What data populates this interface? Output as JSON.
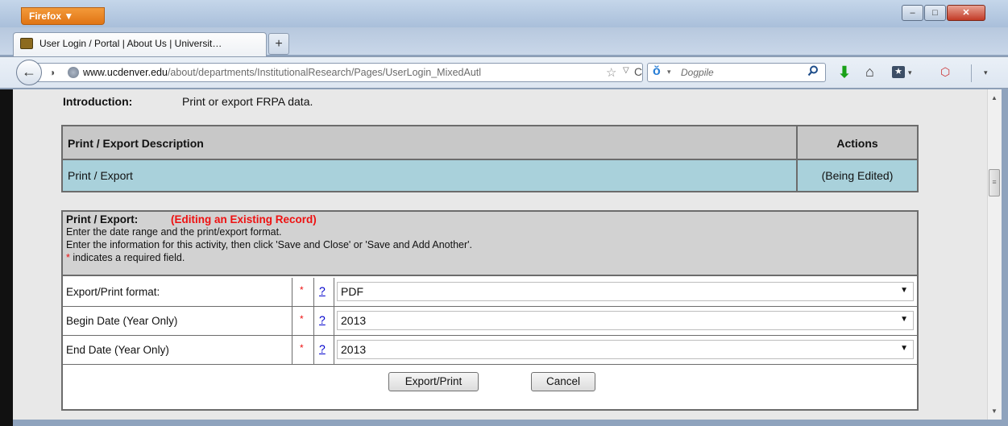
{
  "browser": {
    "menu_label": "Firefox ▼",
    "window_controls": {
      "minimize": "–",
      "maximize": "□",
      "close": "✕"
    },
    "tab": {
      "title": "User Login / Portal | About Us | Universit…",
      "new_tab": "+"
    },
    "url": {
      "domain": "www.ucdenver.edu",
      "path": "/about/departments/InstitutionalResearch/Pages/UserLogin_MixedAutl"
    },
    "search_placeholder": "Dogpile",
    "icons": {
      "back": "←",
      "identity": "◑",
      "star": "☆",
      "dropdown": "▽",
      "reload": "C",
      "search_engine": "ŏ",
      "caret": "▾",
      "download": "⬇",
      "home": "⌂",
      "bookmarks": "★",
      "addon": "⬡",
      "scroll_up": "▲",
      "scroll_down": "▼",
      "grip": "≡"
    }
  },
  "page": {
    "intro": {
      "label": "Introduction:",
      "text": "Print or export FRPA data."
    },
    "list": {
      "headers": {
        "description": "Print / Export Description",
        "actions": "Actions"
      },
      "rows": [
        {
          "description": "Print / Export",
          "action": "(Being Edited)"
        }
      ]
    },
    "form": {
      "title": "Print / Export:",
      "status": "(Editing an Existing Record)",
      "instructions": [
        "Enter the date range and the print/export format.",
        "Enter the information for this activity, then click 'Save and Close' or 'Save and Add Another'."
      ],
      "required_note": {
        "star": "*",
        "text": " indicates a required field."
      },
      "fields": [
        {
          "label": "Export/Print format:",
          "required": "*",
          "help": "?",
          "value": "PDF"
        },
        {
          "label": "Begin Date (Year Only)",
          "required": "*",
          "help": "?",
          "value": "2013"
        },
        {
          "label": "End Date (Year Only)",
          "required": "*",
          "help": "?",
          "value": "2013"
        }
      ],
      "buttons": {
        "export_print": "Export/Print",
        "cancel": "Cancel"
      }
    }
  },
  "colors": {
    "row_highlight": "#a9d1db",
    "header_gray": "#c8c8c8",
    "status_red": "#ee1111",
    "firefox_orange": "#e07414"
  }
}
